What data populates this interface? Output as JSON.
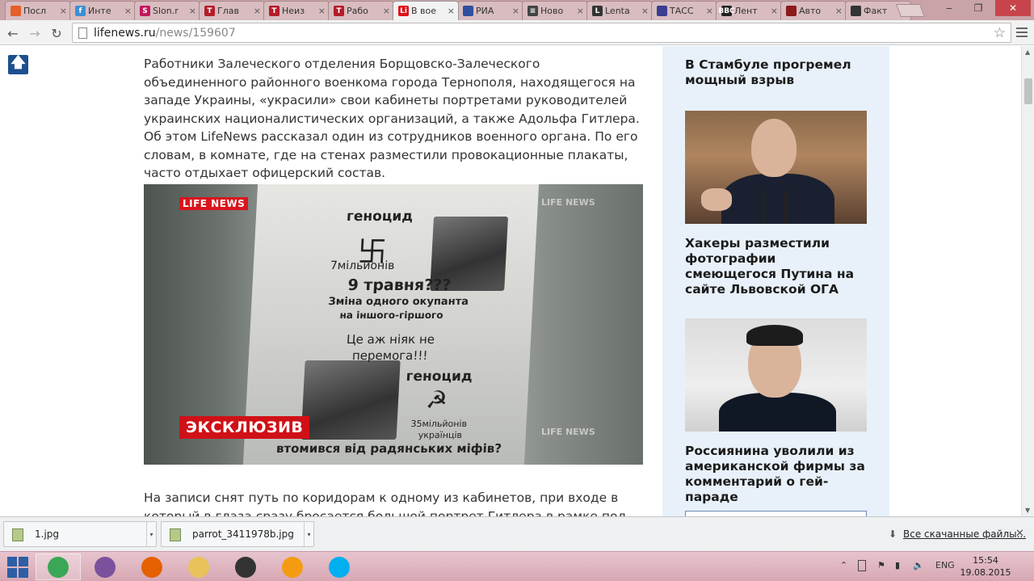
{
  "tabs": [
    {
      "label": "Посл",
      "favicon_color": "#e45f2b",
      "favicon_glyph": ""
    },
    {
      "label": "Инте",
      "favicon_color": "#3b8fd4",
      "favicon_glyph": "f"
    },
    {
      "label": "Slon.r",
      "favicon_color": "#c2185b",
      "favicon_glyph": "S"
    },
    {
      "label": "Глав",
      "favicon_color": "#b51c2a",
      "favicon_glyph": "T"
    },
    {
      "label": "Неиз",
      "favicon_color": "#b51c2a",
      "favicon_glyph": "T"
    },
    {
      "label": "Рабо",
      "favicon_color": "#b51c2a",
      "favicon_glyph": "T"
    },
    {
      "label": "В вое",
      "favicon_color": "#e0101a",
      "favicon_glyph": "Li",
      "active": true
    },
    {
      "label": "РИА",
      "favicon_color": "#2f4f9f",
      "favicon_glyph": ""
    },
    {
      "label": "Ново",
      "favicon_color": "#444444",
      "favicon_glyph": "≡"
    },
    {
      "label": "Lenta",
      "favicon_color": "#333333",
      "favicon_glyph": "L"
    },
    {
      "label": "ТАСС",
      "favicon_color": "#3a3f8f",
      "favicon_glyph": ""
    },
    {
      "label": "Лент",
      "favicon_color": "#222222",
      "favicon_glyph": "BBC"
    },
    {
      "label": "Авто",
      "favicon_color": "#8b1a1a",
      "favicon_glyph": ""
    },
    {
      "label": "Факт",
      "favicon_color": "#333333",
      "favicon_glyph": ""
    }
  ],
  "tab_close_glyph": "×",
  "window_controls": {
    "minimize": "‒",
    "maximize": "❐",
    "close": "✕"
  },
  "toolbar": {
    "back": "←",
    "forward": "→",
    "reload": "↻",
    "url_host": "lifenews.ru",
    "url_path": "/news/159607",
    "star": "☆"
  },
  "article": {
    "up_button": "🡅",
    "paragraph1": "Работники Залеческого отделения Борщовско-Залеческого объединенного районного военкома города Тернополя, находящегося на западе Украины, «украсили» свои кабинеты портретами руководителей украинских националистических организаций, а также Адольфа Гитлера. Об этом LifeNews рассказал один из сотрудников военного органа. По его словам, в комнате, где на стенах разместили провокационные плакаты, часто отдыхает офицерский состав.",
    "paragraph2": "На записи снят путь по коридорам к одному из кабинетов, при входе в который в глаза сразу бросается большой портрет Гитлера в рамке под большим",
    "photo": {
      "logo": "LIFE NEWS",
      "watermark": "LIFE NEWS",
      "badge": "ЭКСКЛЮЗИВ",
      "poster_lines": [
        "геноцид",
        "7мільйонів",
        "9 травня???",
        "Зміна одного окупанта",
        "на іншого-гіршого",
        "Це аж ніяк не",
        "перемога!!!",
        "геноцид",
        "35мільйонів",
        "українців",
        "втомився від радянських міфів?"
      ],
      "symbol_swastika": "卐",
      "symbol_hammer_sickle": "☭"
    }
  },
  "sidebar": {
    "headline1": "В Стамбуле прогремел мощный взрыв",
    "headline2": "Хакеры разместили фотографии смеющегося Путина на сайте Львовской ОГА",
    "headline3": "Россиянина уволили из американской фирмы за комментарий о гей-параде"
  },
  "downloads": {
    "items": [
      {
        "name": "1.jpg"
      },
      {
        "name": "parrot_3411978b.jpg"
      }
    ],
    "dropdown_glyph": "▾",
    "show_all": "Все скачанные файлы...",
    "download_glyph": "⬇",
    "close": "✕"
  },
  "taskbar": {
    "apps": [
      {
        "name": "chrome",
        "color": "#3aa757"
      },
      {
        "name": "viber",
        "color": "#7b519d"
      },
      {
        "name": "firefox",
        "color": "#e66000"
      },
      {
        "name": "explorer",
        "color": "#e8c25a"
      },
      {
        "name": "camera",
        "color": "#333333"
      },
      {
        "name": "aimp",
        "color": "#f39c12"
      },
      {
        "name": "skype",
        "color": "#00aff0"
      }
    ],
    "tray_lang": "ENG",
    "tray_arrow": "⌃",
    "clock_time": "15:54",
    "clock_date": "19.08.2015"
  }
}
